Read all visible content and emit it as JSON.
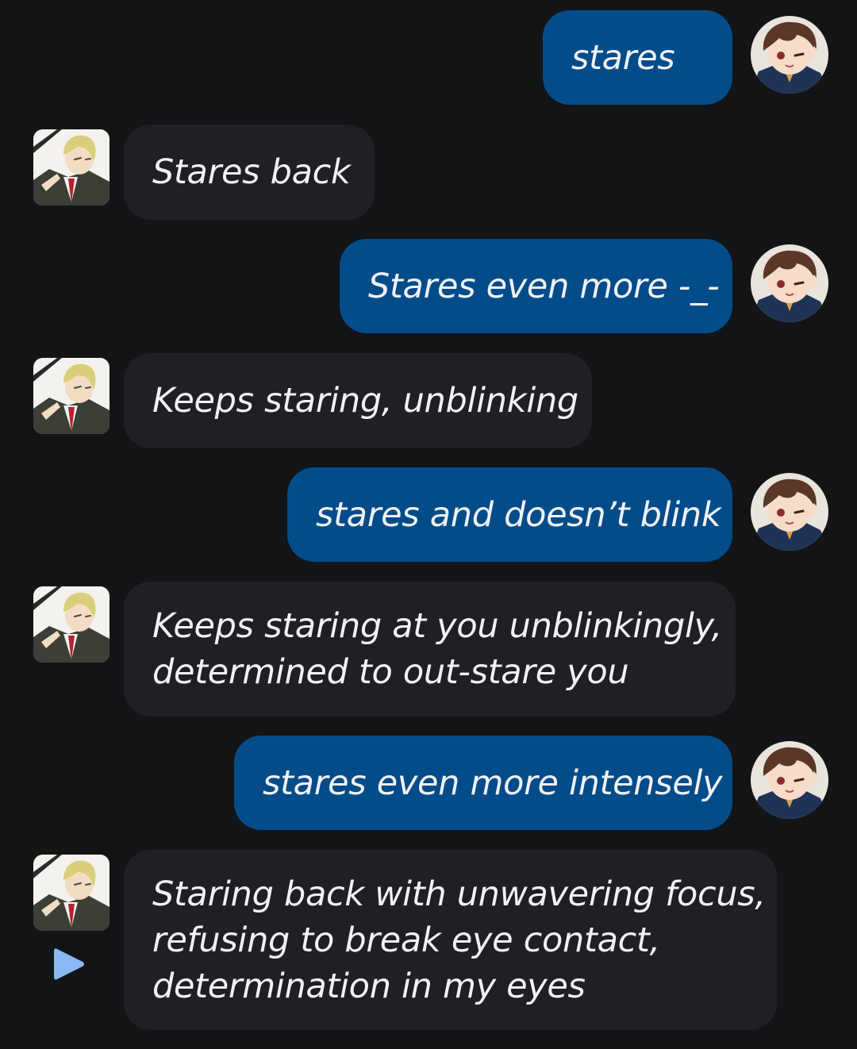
{
  "messages": [
    {
      "sender": "user",
      "text": "stares"
    },
    {
      "sender": "bot",
      "text": "Stares back"
    },
    {
      "sender": "user",
      "text": "Stares even more -_-"
    },
    {
      "sender": "bot",
      "text": "Keeps staring, unblinking"
    },
    {
      "sender": "user",
      "text": "stares and doesn’t blink"
    },
    {
      "sender": "bot",
      "lines": [
        "Keeps staring at you unblinkingly,",
        "determined to out-stare you"
      ]
    },
    {
      "sender": "user",
      "text": "stares even more intensely"
    },
    {
      "sender": "bot",
      "lines": [
        "Staring back with unwavering focus,",
        "refusing to break eye contact,",
        "determination in my eyes"
      ]
    }
  ],
  "avatars": {
    "user": "user-avatar-anime-brown-hair",
    "bot": "bot-avatar-anime-blonde-suit"
  },
  "controls": {
    "play_icon": "play-icon"
  },
  "colors": {
    "background": "#131416",
    "user_bubble": "#034c8a",
    "bot_bubble": "#1f2024",
    "text": "#f1f2f4",
    "play_icon": "#8ab8f4"
  }
}
